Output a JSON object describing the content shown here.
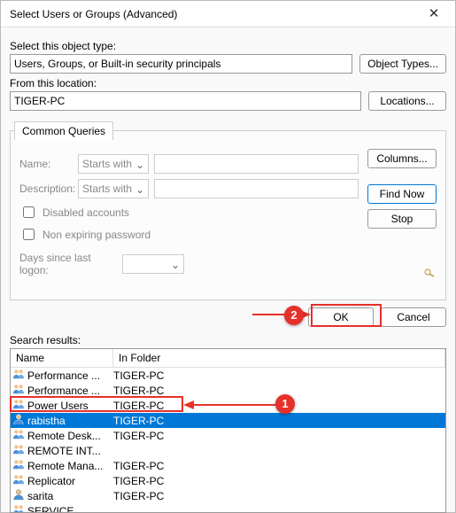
{
  "title": "Select Users or Groups (Advanced)",
  "labels": {
    "objType": "Select this object type:",
    "fromLoc": "From this location:",
    "objTypesBtn": "Object Types...",
    "locationsBtn": "Locations...",
    "commonQueries": "Common Queries",
    "name": "Name:",
    "desc": "Description:",
    "startsWith": "Starts with",
    "disabled": "Disabled accounts",
    "nonExp": "Non expiring password",
    "daysSince": "Days since last logon:",
    "columns": "Columns...",
    "findNow": "Find Now",
    "stop": "Stop",
    "ok": "OK",
    "cancel": "Cancel",
    "searchResults": "Search results:",
    "hdrName": "Name",
    "hdrFolder": "In Folder"
  },
  "values": {
    "objType": "Users, Groups, or Built-in security principals",
    "location": "TIGER-PC"
  },
  "rows": [
    {
      "name": "Performance ...",
      "folder": "TIGER-PC",
      "icon": "group",
      "sel": false
    },
    {
      "name": "Performance ...",
      "folder": "TIGER-PC",
      "icon": "group",
      "sel": false
    },
    {
      "name": "Power Users",
      "folder": "TIGER-PC",
      "icon": "group",
      "sel": false
    },
    {
      "name": "rabistha",
      "folder": "TIGER-PC",
      "icon": "user",
      "sel": true
    },
    {
      "name": "Remote Desk...",
      "folder": "TIGER-PC",
      "icon": "group",
      "sel": false
    },
    {
      "name": "REMOTE INT...",
      "folder": "",
      "icon": "group",
      "sel": false
    },
    {
      "name": "Remote Mana...",
      "folder": "TIGER-PC",
      "icon": "group",
      "sel": false
    },
    {
      "name": "Replicator",
      "folder": "TIGER-PC",
      "icon": "group",
      "sel": false
    },
    {
      "name": "sarita",
      "folder": "TIGER-PC",
      "icon": "user",
      "sel": false
    },
    {
      "name": "SERVICE",
      "folder": "",
      "icon": "group",
      "sel": false
    }
  ],
  "callouts": {
    "one": "1",
    "two": "2"
  }
}
